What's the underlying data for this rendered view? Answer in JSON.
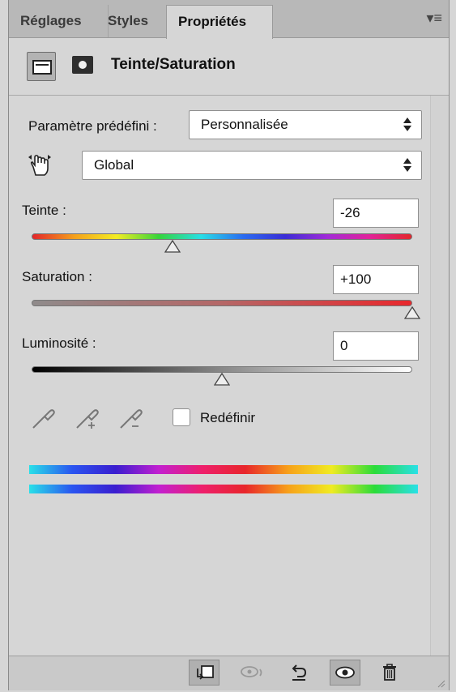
{
  "tabs": [
    {
      "label": "Réglages",
      "active": false
    },
    {
      "label": "Styles",
      "active": false
    },
    {
      "label": "Propriétés",
      "active": true
    }
  ],
  "header": {
    "title": "Teinte/Saturation"
  },
  "preset": {
    "label": "Paramètre prédéfini :",
    "value": "Personnalisée"
  },
  "channel": {
    "value": "Global"
  },
  "sliders": {
    "hue": {
      "label": "Teinte :",
      "value": "-26",
      "fraction": 0.37
    },
    "saturation": {
      "label": "Saturation :",
      "value": "+100",
      "fraction": 1.0
    },
    "lightness": {
      "label": "Luminosité :",
      "value": "0",
      "fraction": 0.5
    }
  },
  "colorize": {
    "label": "Redéfinir",
    "checked": false
  },
  "icons": {
    "panel_menu": "panel-menu-icon",
    "adjustment": "adjustment-layer-icon",
    "mask": "mask-icon",
    "hand": "targeted-adjustment-hand-icon",
    "bottom": [
      "clip-to-layer-icon",
      "view-previous-state-icon",
      "reset-icon",
      "visibility-eye-icon",
      "trash-icon"
    ]
  },
  "colors": {
    "panel_bg": "#d6d6d6",
    "tab_bar": "#b8b8b8",
    "saturation_end": "#e8272c"
  }
}
